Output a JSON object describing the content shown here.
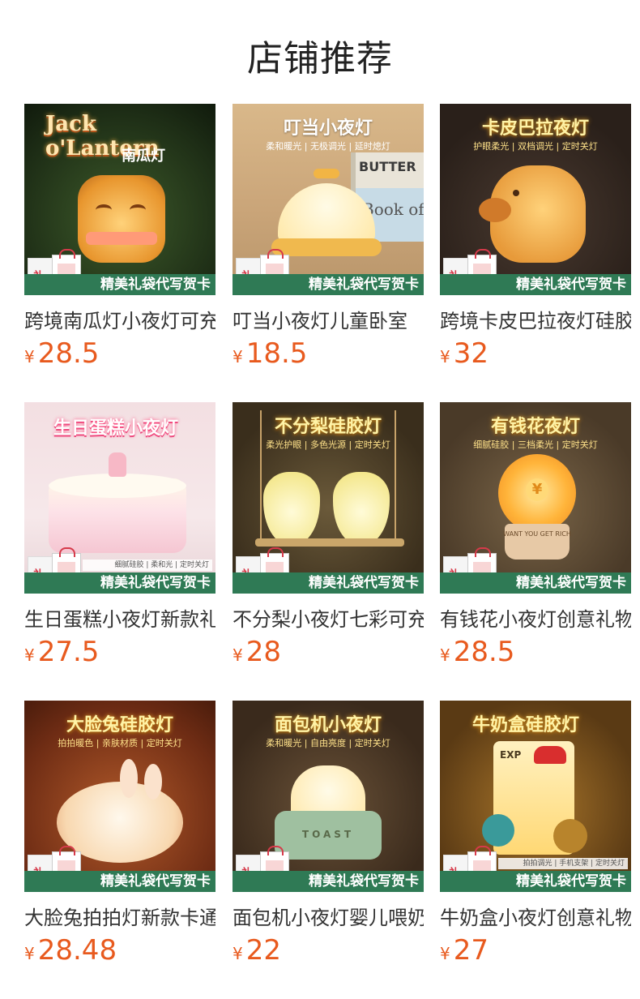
{
  "page": {
    "title": "店铺推荐"
  },
  "products": [
    {
      "name": "跨境南瓜灯小夜灯可充电",
      "currency": "¥",
      "price": "28.5",
      "image": {
        "headline": "Jack o'Lantern",
        "subtitle": "南瓜灯",
        "banner": "精美礼袋代写贺卡",
        "bag_text": "礼物"
      }
    },
    {
      "name": "叮当小夜灯儿童卧室",
      "currency": "¥",
      "price": "18.5",
      "image": {
        "headline": "叮当小夜灯",
        "subtitle": "柔和暖光 | 无极调光 | 延时熄灯",
        "banner": "精美礼袋代写贺卡",
        "bag_text": "礼物",
        "book1": "BUTTER",
        "book2": "Book of"
      }
    },
    {
      "name": "跨境卡皮巴拉夜灯硅胶",
      "currency": "¥",
      "price": "32",
      "image": {
        "headline": "卡皮巴拉夜灯",
        "subtitle": "护眼柔光 | 双档调光 | 定时关灯",
        "banner": "精美礼袋代写贺卡",
        "bag_text": "礼物"
      }
    },
    {
      "name": "生日蛋糕小夜灯新款礼物",
      "currency": "¥",
      "price": "27.5",
      "image": {
        "headline": "生日蛋糕小夜灯",
        "tags": "细腻硅胶 | 柔和光 | 定时关灯",
        "banner": "精美礼袋代写贺卡",
        "bag_text": "礼物"
      }
    },
    {
      "name": "不分梨小夜灯七彩可充电",
      "currency": "¥",
      "price": "28",
      "image": {
        "headline": "不分梨硅胶灯",
        "subtitle": "柔光护眼 | 多色光源 | 定时关灯",
        "banner": "精美礼袋代写贺卡",
        "bag_text": "礼物"
      }
    },
    {
      "name": "有钱花小夜灯创意礼物",
      "currency": "¥",
      "price": "28.5",
      "image": {
        "headline": "有钱花夜灯",
        "subtitle": "细腻硅胶 | 三档柔光 | 定时关灯",
        "banner": "精美礼袋代写贺卡",
        "bag_text": "礼物",
        "pot_text": "WANT YOU GET RICH"
      }
    },
    {
      "name": "大脸兔拍拍灯新款卡通",
      "currency": "¥",
      "price": "28.48",
      "image": {
        "headline": "大脸兔硅胶灯",
        "subtitle": "拍拍暖色 | 亲肤材质 | 定时关灯",
        "banner": "精美礼袋代写贺卡",
        "bag_text": "礼物"
      }
    },
    {
      "name": "面包机小夜灯婴儿喂奶",
      "currency": "¥",
      "price": "22",
      "image": {
        "headline": "面包机小夜灯",
        "subtitle": "柔和暖光 | 自由亮度 | 定时关灯",
        "banner": "精美礼袋代写贺卡",
        "bag_text": "礼物",
        "toaster_text": "TOAST"
      }
    },
    {
      "name": "牛奶盒小夜灯创意礼物",
      "currency": "¥",
      "price": "27",
      "image": {
        "headline": "牛奶盒硅胶灯",
        "tags": "拍拍调光 | 手机支架 | 定时关灯",
        "banner": "精美礼袋代写贺卡",
        "bag_text": "礼物",
        "box_text": "EXP"
      }
    }
  ],
  "colors": {
    "price": "#e85a1e",
    "banner": "#2f7a55"
  }
}
